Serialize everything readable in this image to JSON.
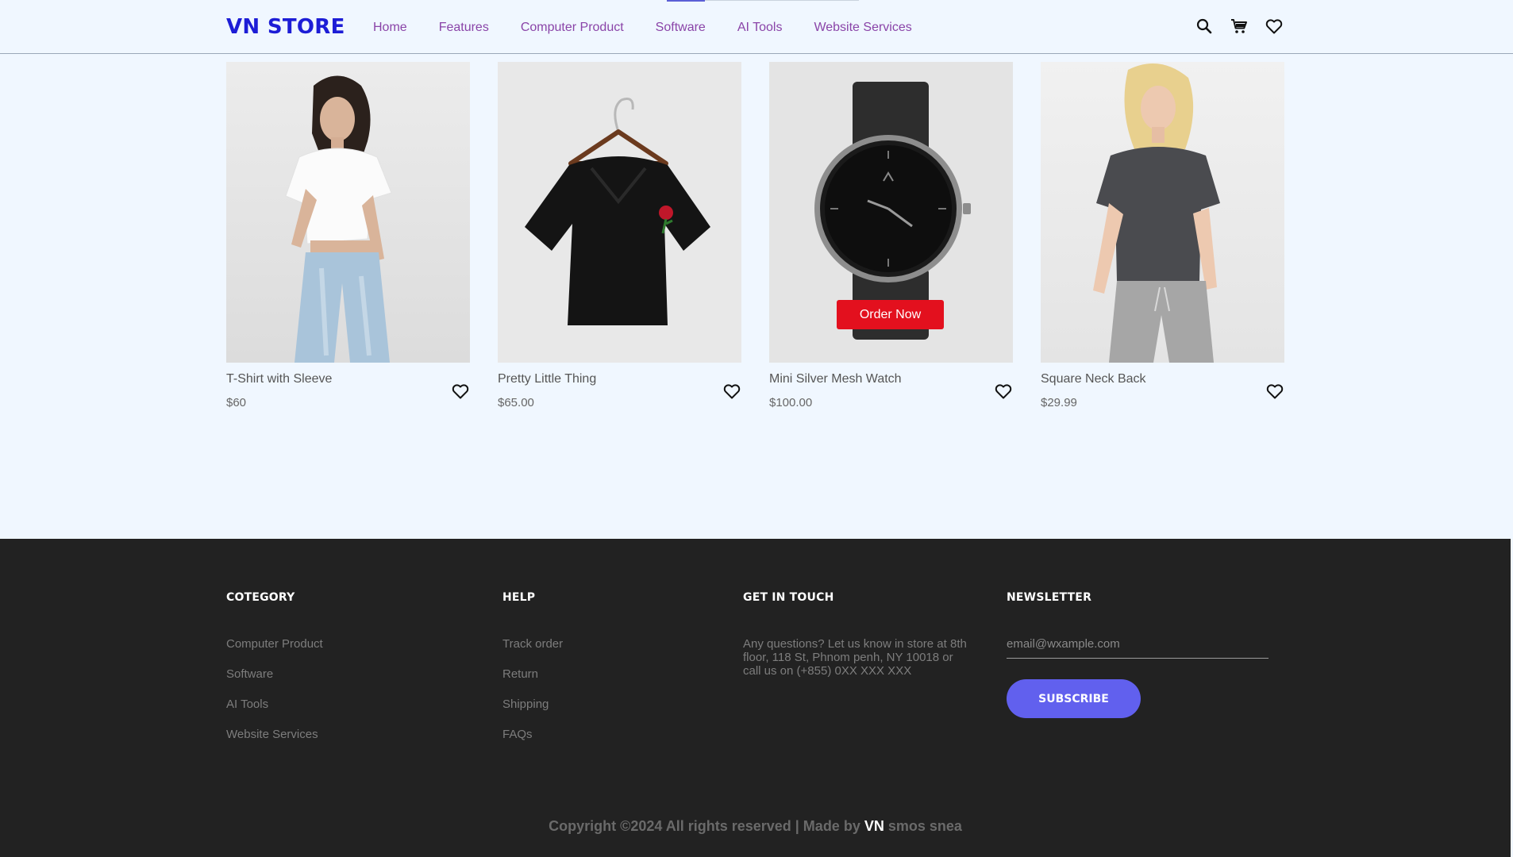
{
  "header": {
    "logo": "VN STORE",
    "nav": [
      "Home",
      "Features",
      "Computer Product",
      "Software",
      "AI Tools",
      "Website Services"
    ],
    "icons": [
      "search-icon",
      "cart-icon",
      "heart-icon"
    ]
  },
  "products": [
    {
      "name": "T-Shirt with Sleeve",
      "price": "$60",
      "image": "woman-white-tshirt-jeans"
    },
    {
      "name": "Pretty Little Thing",
      "price": "$65.00",
      "image": "black-crop-top-on-hanger"
    },
    {
      "name": "Mini Silver Mesh Watch",
      "price": "$100.00",
      "image": "black-mesh-watch",
      "button": "Order Now"
    },
    {
      "name": "Square Neck Back",
      "price": "$29.99",
      "image": "woman-grey-tshirt"
    }
  ],
  "footer": {
    "category": {
      "title": "COTEGORY",
      "items": [
        "Computer Product",
        "Software",
        "AI Tools",
        "Website Services"
      ]
    },
    "help": {
      "title": "HELP",
      "items": [
        "Track order",
        "Return",
        "Shipping",
        "FAQs"
      ]
    },
    "contact": {
      "title": "GET IN TOUCH",
      "text": "Any questions? Let us know in store at 8th floor, 118 St, Phnom penh, NY 10018 or call us on (+855) 0XX XXX XXX"
    },
    "newsletter": {
      "title": "NEWSLETTER",
      "placeholder": "email@wxample.com",
      "button": "SUBSCRIBE"
    },
    "copyright": {
      "prefix": "Copyright ©2024 All rights reserved | Made by ",
      "brand": "VN",
      "suffix": " smos snea"
    }
  },
  "colors": {
    "logo": "#1d1dd6",
    "nav": "#8a44a8",
    "order_button": "#e3101e",
    "subscribe": "#6160ee",
    "footer_bg": "#222222",
    "page_bg": "#f0f7ff"
  }
}
